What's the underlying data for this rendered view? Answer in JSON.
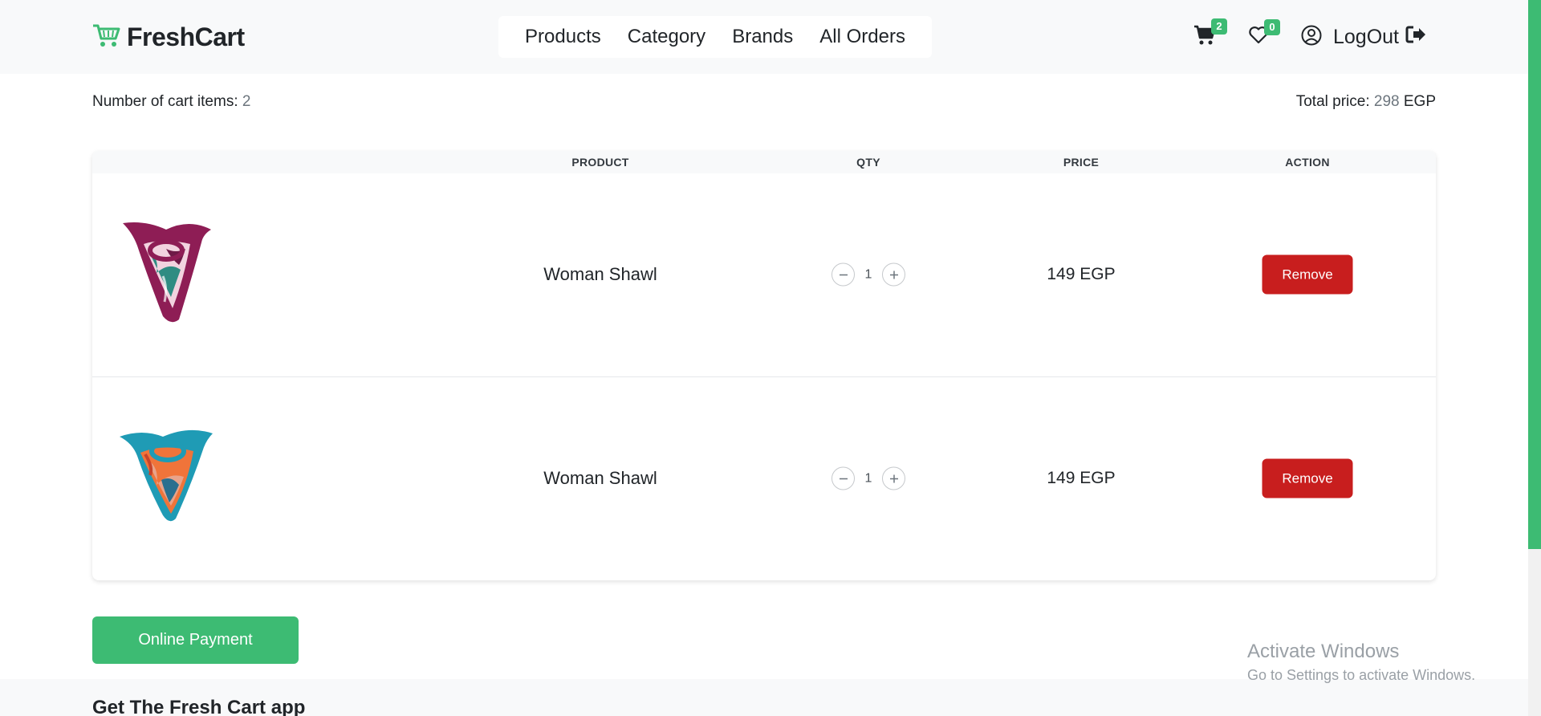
{
  "brand": {
    "name": "FreshCart"
  },
  "nav": {
    "links": [
      "Products",
      "Category",
      "Brands",
      "All Orders"
    ]
  },
  "header": {
    "cart_count": "2",
    "wishlist_count": "0",
    "logout_label": "LogOut"
  },
  "cart": {
    "items_label": "Number of cart items:",
    "items_count": "2",
    "total_label": "Total price:",
    "total_value": "298",
    "currency": "EGP",
    "columns": [
      "PRODUCT",
      "QTY",
      "PRICE",
      "ACTION"
    ],
    "rows": [
      {
        "name": "Woman Shawl",
        "qty": "1",
        "price": "149 EGP",
        "action": "Remove"
      },
      {
        "name": "Woman Shawl",
        "qty": "1",
        "price": "149 EGP",
        "action": "Remove"
      }
    ]
  },
  "payment": {
    "label": "Online Payment"
  },
  "footer": {
    "title": "Get The Fresh Cart app"
  },
  "watermark": {
    "line1": "Activate Windows",
    "line2": "Go to Settings to activate Windows."
  },
  "colors": {
    "accent": "#3dbb73",
    "danger": "#c81e1e",
    "navbar_bg": "#f8f9fa"
  },
  "icons": {
    "brand": "shopping-cart-icon",
    "cart": "cart-icon",
    "wishlist": "heart-icon",
    "profile": "user-circle-icon",
    "logout": "sign-out-icon",
    "qty_minus": "minus-icon",
    "qty_plus": "plus-icon"
  }
}
